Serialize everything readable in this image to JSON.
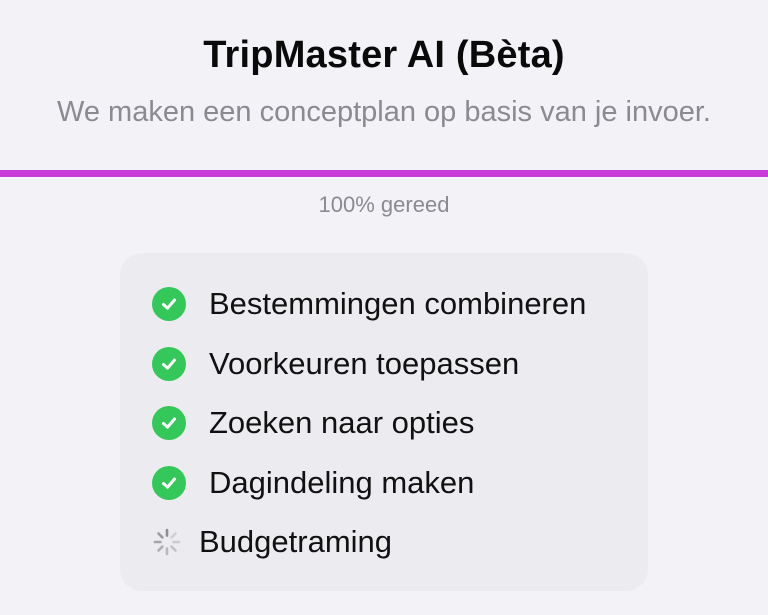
{
  "header": {
    "title": "TripMaster AI (Bèta)",
    "subtitle": "We maken een conceptplan op basis van je invoer."
  },
  "progress": {
    "percent": 100,
    "label": "100% gereed",
    "color": "#c93bd8"
  },
  "steps": [
    {
      "label": "Bestemmingen combineren",
      "status": "done",
      "icon": "checkmark-circle-icon"
    },
    {
      "label": "Voorkeuren toepassen",
      "status": "done",
      "icon": "checkmark-circle-icon"
    },
    {
      "label": "Zoeken naar opties",
      "status": "done",
      "icon": "checkmark-circle-icon"
    },
    {
      "label": "Dagindeling maken",
      "status": "done",
      "icon": "checkmark-circle-icon"
    },
    {
      "label": "Budgetraming",
      "status": "in-progress",
      "icon": "spinner-icon"
    }
  ],
  "colors": {
    "done": "#34c759",
    "accent": "#c93bd8"
  }
}
